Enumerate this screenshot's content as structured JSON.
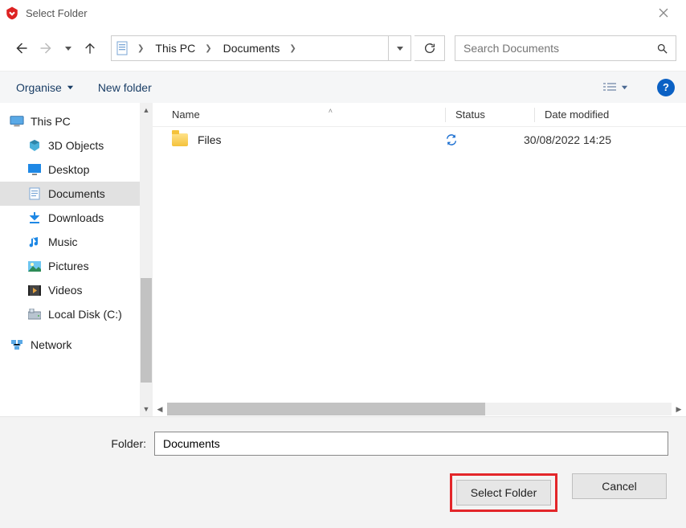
{
  "title": "Select Folder",
  "breadcrumbs": [
    "This PC",
    "Documents"
  ],
  "search": {
    "placeholder": "Search Documents"
  },
  "toolbar": {
    "organise": "Organise",
    "newfolder": "New folder"
  },
  "columns": {
    "name": "Name",
    "status": "Status",
    "date": "Date modified"
  },
  "tree": {
    "root": "This PC",
    "items": [
      "3D Objects",
      "Desktop",
      "Documents",
      "Downloads",
      "Music",
      "Pictures",
      "Videos",
      "Local Disk (C:)"
    ],
    "selected_index": 2,
    "network": "Network"
  },
  "rows": [
    {
      "name": "Files",
      "status": "sync",
      "date": "30/08/2022 14:25"
    }
  ],
  "footer": {
    "label": "Folder:",
    "value": "Documents",
    "select": "Select Folder",
    "cancel": "Cancel"
  },
  "help": "?"
}
